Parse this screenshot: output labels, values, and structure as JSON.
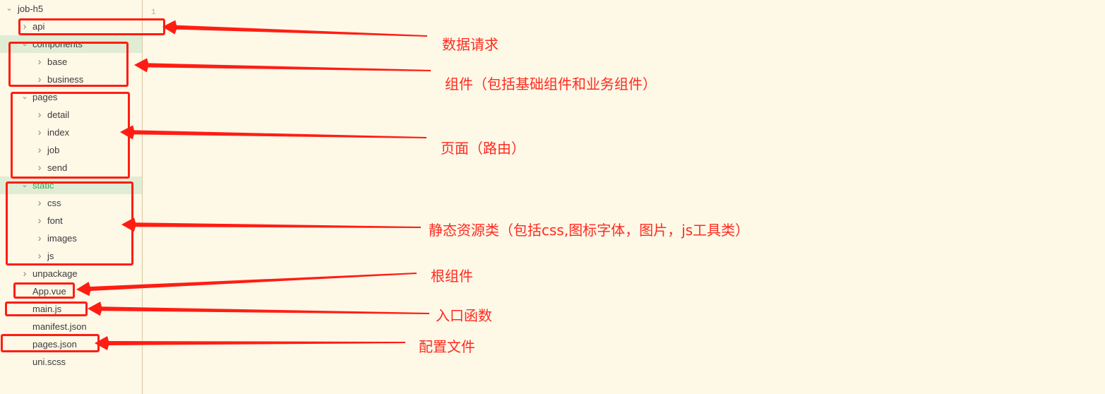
{
  "editor": {
    "line_number": "1"
  },
  "tree": {
    "root": {
      "label": "job-h5",
      "icon": "chevron-down-icon"
    },
    "items": [
      {
        "label": "api",
        "icon": "chevron-right-icon",
        "level": 1
      },
      {
        "label": "components",
        "icon": "chevron-down-icon",
        "level": 1,
        "selected": true
      },
      {
        "label": "base",
        "icon": "chevron-right-icon",
        "level": 2
      },
      {
        "label": "business",
        "icon": "chevron-right-icon",
        "level": 2
      },
      {
        "label": "pages",
        "icon": "chevron-down-icon",
        "level": 1
      },
      {
        "label": "detail",
        "icon": "chevron-right-icon",
        "level": 2
      },
      {
        "label": "index",
        "icon": "chevron-right-icon",
        "level": 2
      },
      {
        "label": "job",
        "icon": "chevron-right-icon",
        "level": 2
      },
      {
        "label": "send",
        "icon": "chevron-right-icon",
        "level": 2
      },
      {
        "label": "static",
        "icon": "chevron-down-icon",
        "level": 1,
        "selected": true,
        "color": "#3ea35a"
      },
      {
        "label": "css",
        "icon": "chevron-right-icon",
        "level": 2
      },
      {
        "label": "font",
        "icon": "chevron-right-icon",
        "level": 2
      },
      {
        "label": "images",
        "icon": "chevron-right-icon",
        "level": 2
      },
      {
        "label": "js",
        "icon": "chevron-right-icon",
        "level": 2
      },
      {
        "label": "unpackage",
        "icon": "chevron-right-icon",
        "level": 1
      },
      {
        "label": "App.vue",
        "level": 1
      },
      {
        "label": "main.js",
        "level": 1
      },
      {
        "label": "manifest.json",
        "level": 1
      },
      {
        "label": "pages.json",
        "level": 1
      },
      {
        "label": "uni.scss",
        "level": 1
      }
    ]
  },
  "annotations": [
    {
      "target": "api",
      "text": "数据请求"
    },
    {
      "target": "components",
      "text": "组件（包括基础组件和业务组件）"
    },
    {
      "target": "pages",
      "text": "页面（路由）"
    },
    {
      "target": "static",
      "text": "静态资源类（包括css,图标字体，图片，js工具类）"
    },
    {
      "target": "App.vue",
      "text": "根组件"
    },
    {
      "target": "main.js",
      "text": "入口函数"
    },
    {
      "target": "pages.json",
      "text": "配置文件"
    }
  ],
  "colors": {
    "background": "#fef8e7",
    "selected_row": "#e1ecd4",
    "annotation": "#ff1d13",
    "folder_highlight_text": "#3ea35a"
  }
}
